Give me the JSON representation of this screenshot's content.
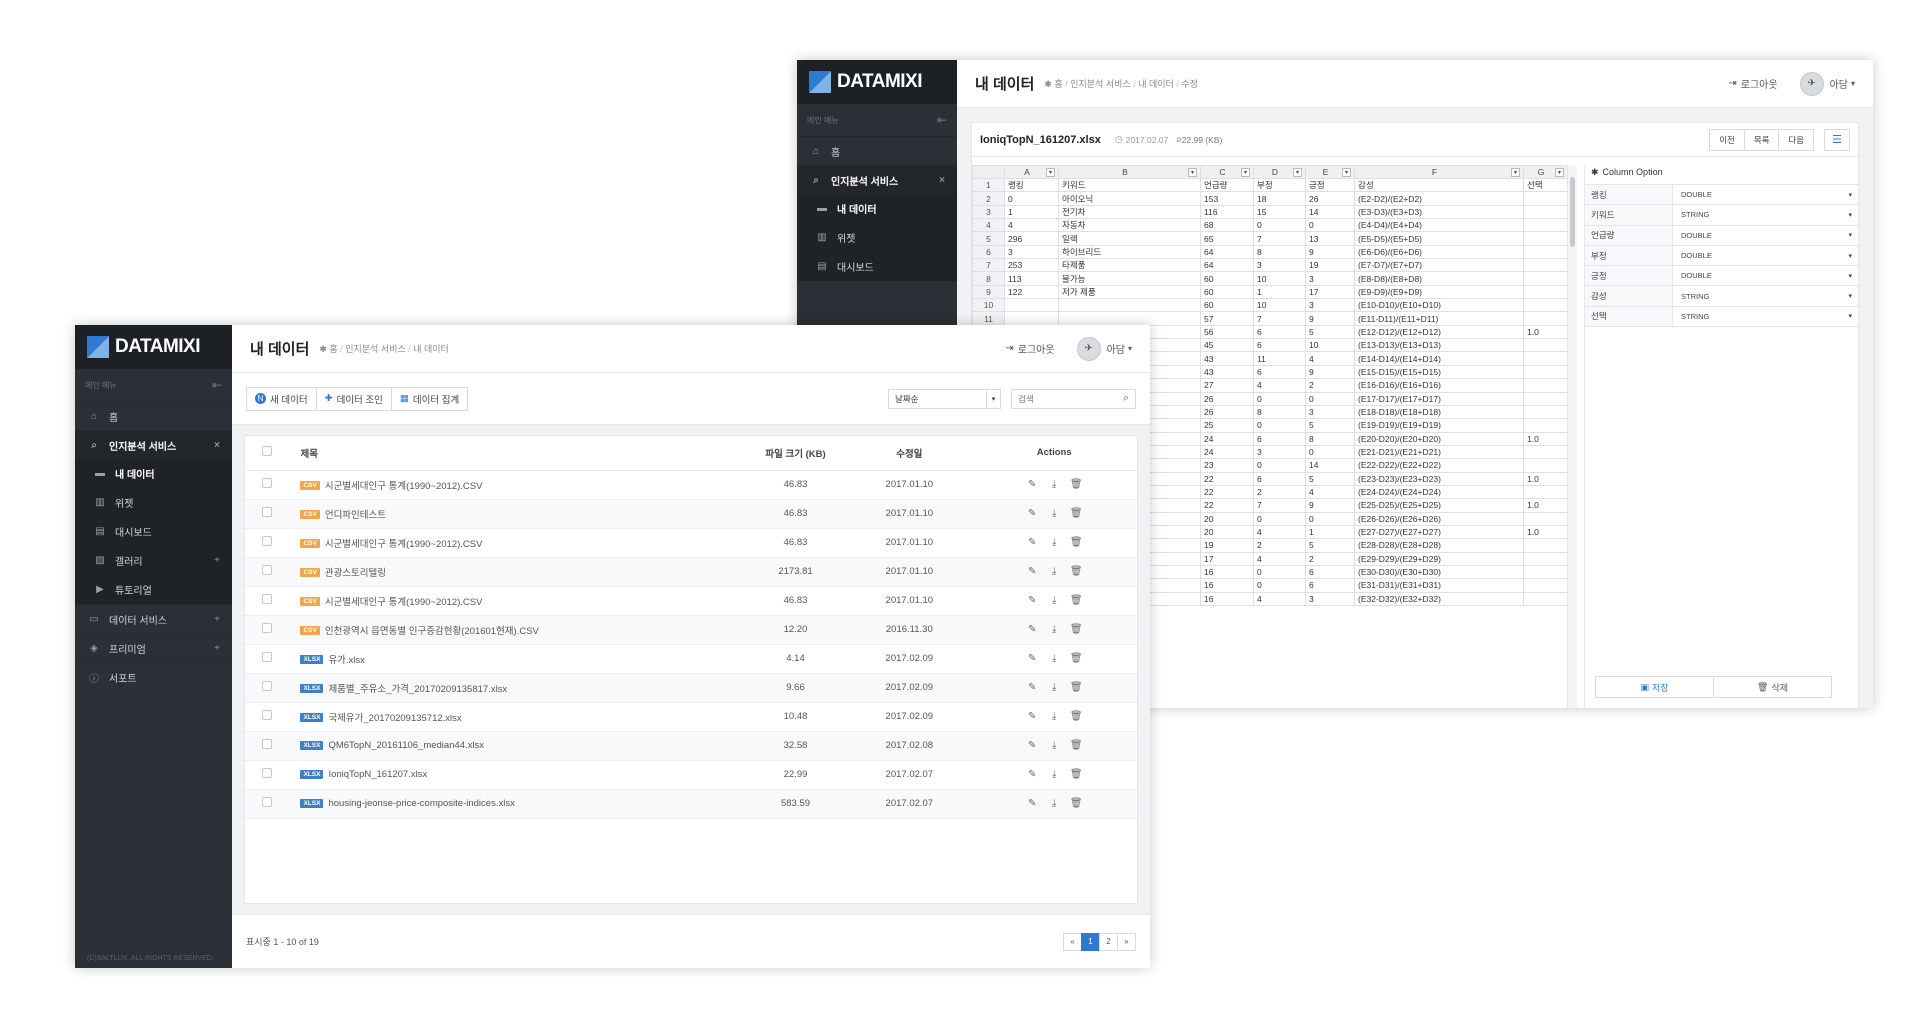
{
  "brand": "DATAMIXI",
  "menu_label": "메인 메뉴",
  "copyright": "(C)SALTLUX. ALL RIGHTS RESERVED.",
  "colors": {
    "sidebar": "#2b2f36",
    "accent": "#2f7ad1",
    "csv_badge": "#f0a64a",
    "xlsx_badge": "#3f7fc6"
  },
  "front": {
    "title": "내 데이터",
    "breadcrumb": [
      "홈",
      "인지분석 서비스",
      "내 데이터"
    ],
    "logout": "로그아웃",
    "user": "아담",
    "sidebar": [
      {
        "label": "홈",
        "icon": "home-icon"
      },
      {
        "label": "인지분석 서비스",
        "icon": "search-icon",
        "tail": "×"
      },
      {
        "label": "내 데이터",
        "icon": "folder-icon",
        "sub": true
      },
      {
        "label": "위젯",
        "icon": "chart-icon",
        "sub": true
      },
      {
        "label": "대시보드",
        "icon": "clipboard-icon",
        "sub": true
      },
      {
        "label": "갤러리",
        "icon": "image-icon",
        "sub": true,
        "tail": "+"
      },
      {
        "label": "튜토리얼",
        "icon": "video-icon",
        "sub": true
      },
      {
        "label": "데이터 서비스",
        "icon": "monitor-icon",
        "tail": "+"
      },
      {
        "label": "프리미엄",
        "icon": "diamond-icon",
        "tail": "+"
      },
      {
        "label": "서포트",
        "icon": "info-icon"
      }
    ],
    "toolbar": {
      "new": "새 데이터",
      "join": "데이터 조인",
      "aggregate": "데이터 집계",
      "sort": "날짜순",
      "search_placeholder": "검색"
    },
    "table": {
      "headers": {
        "title": "제목",
        "size": "파일 크기 (KB)",
        "date": "수정일",
        "actions": "Actions"
      },
      "rows": [
        {
          "type": "CSV",
          "name": "시군별세대인구 통계(1990~2012).CSV",
          "size": "46.83",
          "date": "2017.01.10"
        },
        {
          "type": "CSV",
          "name": "언디파인테스트",
          "size": "46.83",
          "date": "2017.01.10"
        },
        {
          "type": "CSV",
          "name": "시군별세대인구 통계(1990~2012).CSV",
          "size": "46.83",
          "date": "2017.01.10"
        },
        {
          "type": "CSV",
          "name": "관광스토리텔링",
          "size": "2173.81",
          "date": "2017.01.10"
        },
        {
          "type": "CSV",
          "name": "시군별세대인구 통계(1990~2012).CSV",
          "size": "46.83",
          "date": "2017.01.10"
        },
        {
          "type": "CSV",
          "name": "인천광역시 읍면동별 인구증감현황(201601현재).CSV",
          "size": "12.20",
          "date": "2016.11.30"
        },
        {
          "type": "XLSX",
          "name": "유가.xlsx",
          "size": "4.14",
          "date": "2017.02.09"
        },
        {
          "type": "XLSX",
          "name": "제품별_주유소_가격_20170209135817.xlsx",
          "size": "9.66",
          "date": "2017.02.09"
        },
        {
          "type": "XLSX",
          "name": "국제유가_20170209135712.xlsx",
          "size": "10.48",
          "date": "2017.02.09"
        },
        {
          "type": "XLSX",
          "name": "QM6TopN_20161106_median44.xlsx",
          "size": "32.58",
          "date": "2017.02.08"
        },
        {
          "type": "XLSX",
          "name": "IoniqTopN_161207.xlsx",
          "size": "22.99",
          "date": "2017.02.07"
        },
        {
          "type": "XLSX",
          "name": "housing-jeonse-price-composite-indices.xlsx",
          "size": "583.59",
          "date": "2017.02.07"
        }
      ]
    },
    "footer": {
      "showing": "표시중 1 - 10 of 19",
      "pages": [
        "«",
        "1",
        "2",
        "»"
      ],
      "current_page": "1"
    }
  },
  "back": {
    "title": "내 데이터",
    "breadcrumb": [
      "홈",
      "인지분석 서비스",
      "내 데이터",
      "수정"
    ],
    "logout": "로그아웃",
    "user": "아담",
    "sidebar": [
      {
        "label": "홈",
        "icon": "home-icon"
      },
      {
        "label": "인지분석 서비스",
        "icon": "search-icon",
        "tail": "×"
      },
      {
        "label": "내 데이터",
        "icon": "folder-icon",
        "sub": true
      },
      {
        "label": "위젯",
        "icon": "chart-icon",
        "sub": true
      },
      {
        "label": "대시보드",
        "icon": "clipboard-icon",
        "sub": true
      }
    ],
    "file": {
      "name": "IoniqTopN_161207.xlsx",
      "date": "2017.02.07",
      "size": "22.99 (KB)"
    },
    "nav_buttons": [
      "이전",
      "목록",
      "다음"
    ],
    "sheet": {
      "col_letters": [
        "A",
        "B",
        "C",
        "D",
        "E",
        "F",
        "G"
      ],
      "header_row": [
        "랭킹",
        "키워드",
        "언급량",
        "부정",
        "긍정",
        "감성",
        "선택"
      ],
      "rows": [
        [
          "0",
          "아이오닉",
          "153",
          "18",
          "26",
          "(E2-D2)/(E2+D2)",
          ""
        ],
        [
          "1",
          "전기차",
          "116",
          "15",
          "14",
          "(E3-D3)/(E3+D3)",
          ""
        ],
        [
          "4",
          "자동차",
          "68",
          "0",
          "0",
          "(E4-D4)/(E4+D4)",
          ""
        ],
        [
          "296",
          "일렉",
          "65",
          "7",
          "13",
          "(E5-D5)/(E5+D5)",
          ""
        ],
        [
          "3",
          "하이브리드",
          "64",
          "8",
          "9",
          "(E6-D6)/(E6+D6)",
          ""
        ],
        [
          "253",
          "타제품",
          "64",
          "3",
          "19",
          "(E7-D7)/(E7+D7)",
          ""
        ],
        [
          "113",
          "불가능",
          "60",
          "10",
          "3",
          "(E8-D8)/(E8+D8)",
          ""
        ],
        [
          "122",
          "저가 제품",
          "60",
          "1",
          "17",
          "(E9-D9)/(E9+D9)",
          ""
        ],
        [
          "",
          "",
          "60",
          "10",
          "3",
          "(E10-D10)/(E10+D10)",
          ""
        ],
        [
          "",
          "",
          "57",
          "7",
          "9",
          "(E11-D11)/(E11+D11)",
          ""
        ],
        [
          "",
          "",
          "56",
          "6",
          "5",
          "(E12-D12)/(E12+D12)",
          "1.0"
        ],
        [
          "",
          "",
          "45",
          "6",
          "10",
          "(E13-D13)/(E13+D13)",
          ""
        ],
        [
          "",
          "",
          "43",
          "11",
          "4",
          "(E14-D14)/(E14+D14)",
          ""
        ],
        [
          "",
          "",
          "43",
          "6",
          "9",
          "(E15-D15)/(E15+D15)",
          ""
        ],
        [
          "",
          "",
          "27",
          "4",
          "2",
          "(E16-D16)/(E16+D16)",
          ""
        ],
        [
          "",
          "",
          "26",
          "0",
          "0",
          "(E17-D17)/(E17+D17)",
          ""
        ],
        [
          "",
          "",
          "26",
          "8",
          "3",
          "(E18-D18)/(E18+D18)",
          ""
        ],
        [
          "",
          "",
          "25",
          "0",
          "5",
          "(E19-D19)/(E19+D19)",
          ""
        ],
        [
          "",
          "",
          "24",
          "6",
          "8",
          "(E20-D20)/(E20+D20)",
          "1.0"
        ],
        [
          "",
          "",
          "24",
          "3",
          "0",
          "(E21-D21)/(E21+D21)",
          ""
        ],
        [
          "",
          "",
          "23",
          "0",
          "14",
          "(E22-D22)/(E22+D22)",
          ""
        ],
        [
          "",
          "",
          "22",
          "6",
          "5",
          "(E23-D23)/(E23+D23)",
          "1.0"
        ],
        [
          "",
          "",
          "22",
          "2",
          "4",
          "(E24-D24)/(E24+D24)",
          ""
        ],
        [
          "",
          "",
          "22",
          "7",
          "9",
          "(E25-D25)/(E25+D25)",
          "1.0"
        ],
        [
          "",
          "",
          "20",
          "0",
          "0",
          "(E26-D26)/(E26+D26)",
          ""
        ],
        [
          "",
          "",
          "20",
          "4",
          "1",
          "(E27-D27)/(E27+D27)",
          "1.0"
        ],
        [
          "",
          "",
          "19",
          "2",
          "5",
          "(E28-D28)/(E28+D28)",
          ""
        ],
        [
          "",
          "",
          "17",
          "4",
          "2",
          "(E29-D29)/(E29+D29)",
          ""
        ],
        [
          "",
          "",
          "16",
          "0",
          "6",
          "(E30-D30)/(E30+D30)",
          ""
        ],
        [
          "",
          "",
          "16",
          "0",
          "6",
          "(E31-D31)/(E31+D31)",
          ""
        ],
        [
          "",
          "",
          "16",
          "4",
          "3",
          "(E32-D32)/(E32+D32)",
          ""
        ]
      ]
    },
    "column_option": {
      "title": "Column Option",
      "items": [
        {
          "name": "랭킹",
          "type": "DOUBLE"
        },
        {
          "name": "키워드",
          "type": "STRING"
        },
        {
          "name": "언급량",
          "type": "DOUBLE"
        },
        {
          "name": "부정",
          "type": "DOUBLE"
        },
        {
          "name": "긍정",
          "type": "DOUBLE"
        },
        {
          "name": "감성",
          "type": "STRING"
        },
        {
          "name": "선택",
          "type": "STRING"
        }
      ],
      "save": "저장",
      "delete": "삭제"
    }
  }
}
